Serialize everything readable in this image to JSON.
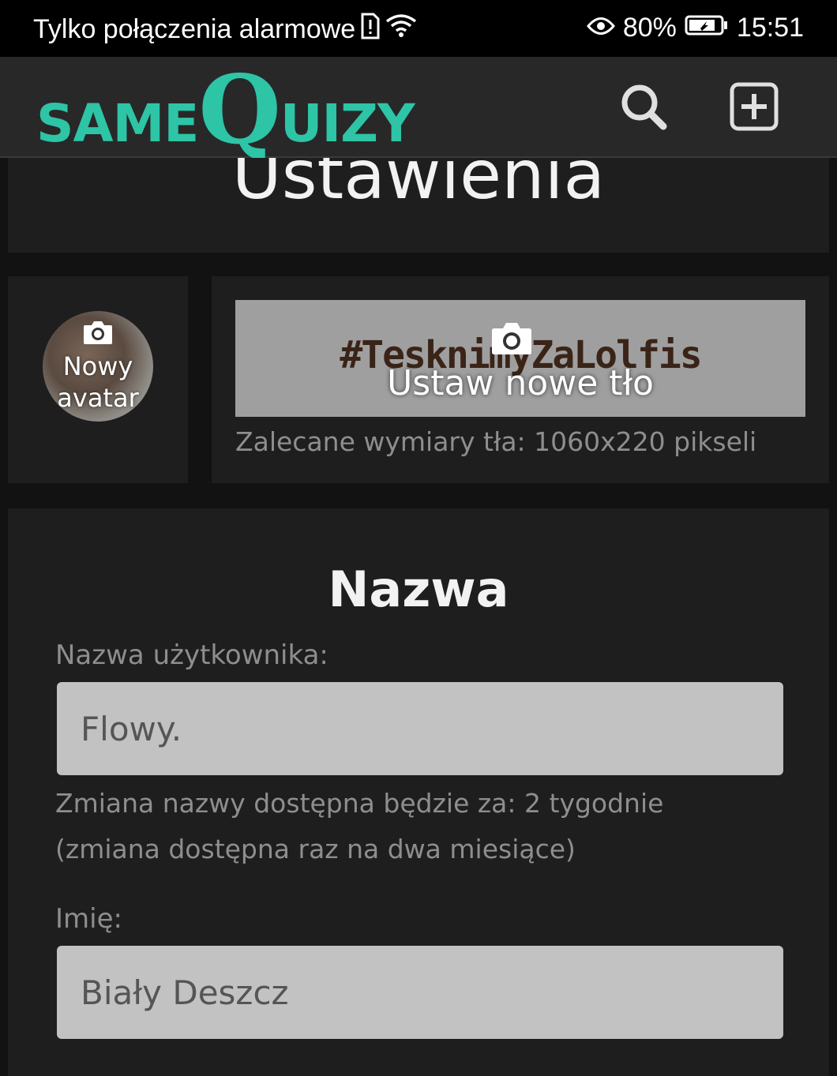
{
  "status_bar": {
    "carrier_text": "Tylko połączenia alarmowe",
    "battery": "80%",
    "time": "15:51",
    "icons": [
      "sim-alert-icon",
      "wifi-icon",
      "eye-icon",
      "battery-icon"
    ]
  },
  "header": {
    "logo_part1": "SAME",
    "logo_part2": "Q",
    "logo_part3": "UIZY",
    "logo_color": "#2ec4a6",
    "icons": [
      "search-icon",
      "add-box-icon"
    ]
  },
  "page": {
    "title": "Ustawienia"
  },
  "avatar": {
    "label_line1": "Nowy",
    "label_line2": "avatar"
  },
  "background": {
    "image_text": "#TesknimyZaLolfis",
    "set_label": "Ustaw nowe tło",
    "hint": "Zalecane wymiary tła: 1060x220 pikseli"
  },
  "name_section": {
    "title": "Nazwa",
    "username_label": "Nazwa użytkownika:",
    "username_value": "Flowy.",
    "change_note": "Zmiana nazwy dostępna będzie za: 2 tygodnie",
    "frequency_note": "(zmiana dostępna raz na dwa miesiące)",
    "first_name_label": "Imię:",
    "first_name_value": "Biały Deszcz"
  }
}
